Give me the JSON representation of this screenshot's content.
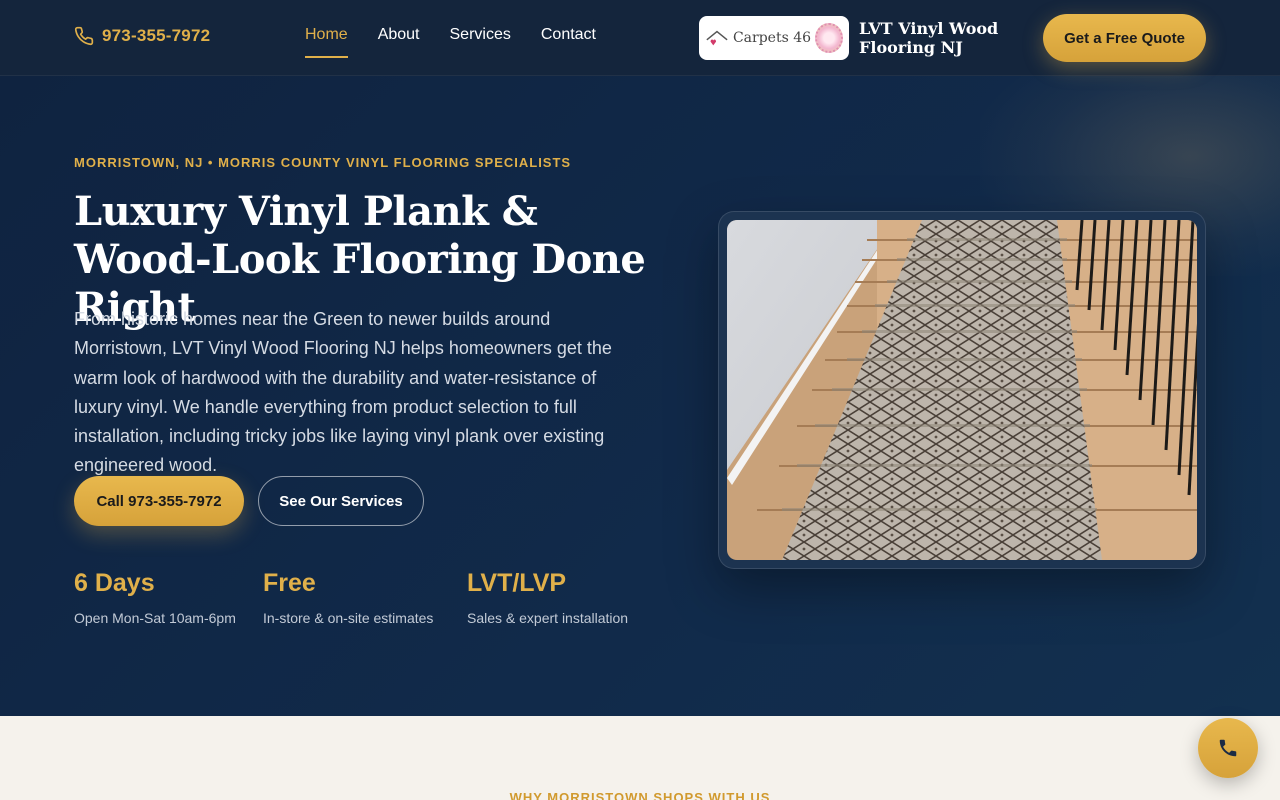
{
  "header": {
    "phone": "973-355-7972",
    "nav": [
      {
        "label": "Home",
        "active": true
      },
      {
        "label": "About",
        "active": false
      },
      {
        "label": "Services",
        "active": false
      },
      {
        "label": "Contact",
        "active": false
      }
    ],
    "logo_text": "Carpets 46",
    "brand_name": "LVT Vinyl Wood Flooring NJ",
    "quote_button": "Get a Free Quote"
  },
  "hero": {
    "eyebrow": "MORRISTOWN, NJ • MORRIS COUNTY VINYL FLOORING SPECIALISTS",
    "title": "Luxury Vinyl Plank & Wood-Look Flooring Done Right",
    "description": "From historic homes near the Green to newer builds around Morristown, LVT Vinyl Wood Flooring NJ helps homeowners get the warm look of hardwood with the durability and water-resistance of luxury vinyl. We handle everything from product selection to full installation, including tricky jobs like laying vinyl plank over existing engineered wood.",
    "call_button": "Call 973-355-7972",
    "services_button": "See Our Services",
    "stats": [
      {
        "value": "6 Days",
        "label": "Open Mon-Sat 10am-6pm"
      },
      {
        "value": "Free",
        "label": "In-store & on-site estimates"
      },
      {
        "value": "LVT/LVP",
        "label": "Sales & expert installation"
      }
    ],
    "image_alt": "Carpet runner on wooden staircase"
  },
  "section2": {
    "eyebrow": "WHY MORRISTOWN SHOPS WITH US"
  },
  "colors": {
    "accent": "#e0b04a",
    "navy": "#0f2542",
    "cream": "#f5f2ec"
  },
  "icons": {
    "header_phone": "phone-icon",
    "float_phone": "phone-icon"
  }
}
